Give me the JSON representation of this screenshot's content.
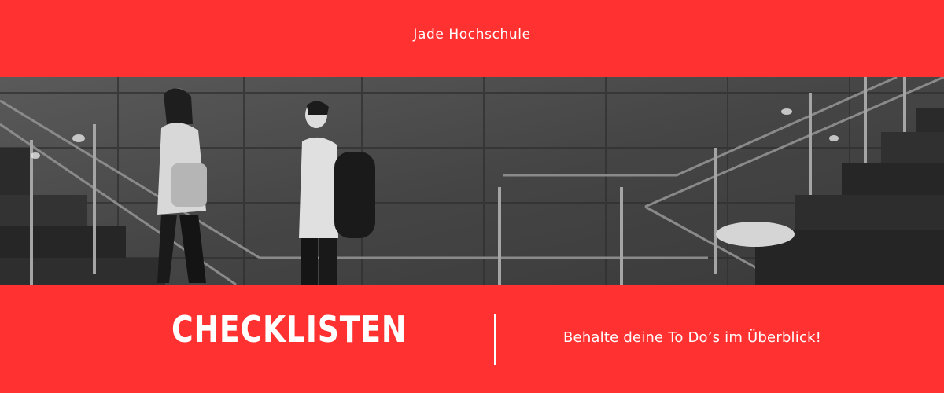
{
  "header": {
    "brand": "Jade Hochschule"
  },
  "hero": {
    "image_desc_icon": "photo-stairs-people"
  },
  "footer": {
    "title": "CHECKLISTEN",
    "tagline": "Behalte deine To Do’s im Überblick!"
  },
  "colors": {
    "accent": "#ff3131",
    "text": "#ffffff"
  }
}
